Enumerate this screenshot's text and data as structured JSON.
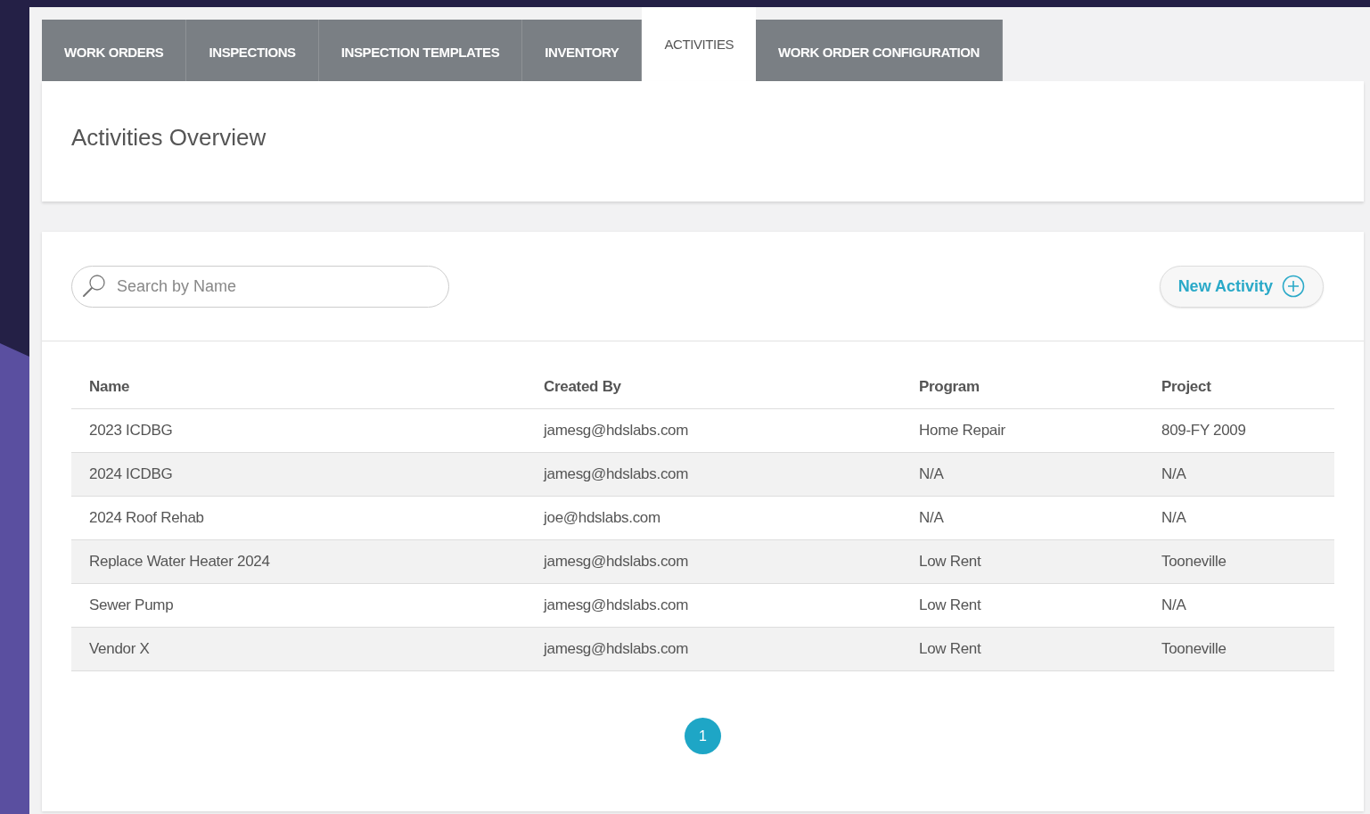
{
  "tabs": [
    {
      "label": "WORK ORDERS",
      "selected": false
    },
    {
      "label": "INSPECTIONS",
      "selected": false
    },
    {
      "label": "INSPECTION TEMPLATES",
      "selected": false
    },
    {
      "label": "INVENTORY",
      "selected": false
    },
    {
      "label": "ACTIVITIES",
      "selected": true
    },
    {
      "label": "WORK ORDER CONFIGURATION",
      "selected": false
    }
  ],
  "header": {
    "title": "Activities Overview"
  },
  "search": {
    "placeholder": "Search by Name"
  },
  "new_button": {
    "label": "New Activity"
  },
  "table": {
    "columns": [
      "Name",
      "Created By",
      "Program",
      "Project"
    ],
    "rows": [
      [
        "2023 ICDBG",
        "jamesg@hdslabs.com",
        "Home Repair",
        "809-FY 2009"
      ],
      [
        "2024 ICDBG",
        "jamesg@hdslabs.com",
        "N/A",
        "N/A"
      ],
      [
        "2024 Roof Rehab",
        "joe@hdslabs.com",
        "N/A",
        "N/A"
      ],
      [
        "Replace Water Heater 2024",
        "jamesg@hdslabs.com",
        "Low Rent",
        "Tooneville"
      ],
      [
        "Sewer Pump",
        "jamesg@hdslabs.com",
        "Low Rent",
        "N/A"
      ],
      [
        "Vendor X",
        "jamesg@hdslabs.com",
        "Low Rent",
        "Tooneville"
      ]
    ]
  },
  "pagination": [
    {
      "label": "1",
      "selected": true
    }
  ]
}
